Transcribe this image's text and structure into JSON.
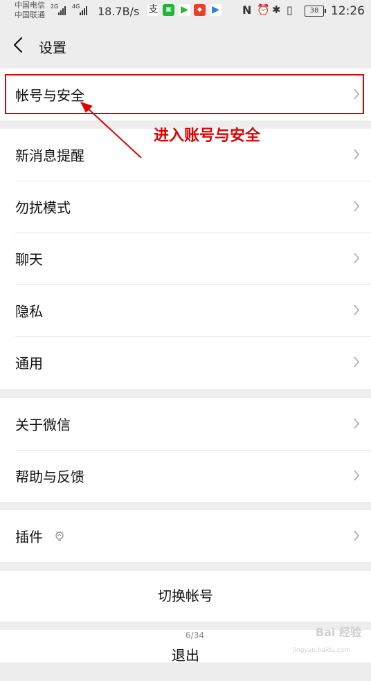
{
  "status_bar": {
    "carrier1": "中国电信",
    "carrier2": "中国联通",
    "net1": "2G",
    "net2": "4G",
    "speed": "18.7B/s",
    "battery": "38",
    "time": "12:26",
    "nfc": "N",
    "alarm": "⏰",
    "bluetooth": "✱",
    "vibrate": "▯"
  },
  "header": {
    "title": "设置"
  },
  "settings": {
    "account_security": "帐号与安全",
    "new_message_notify": "新消息提醒",
    "do_not_disturb": "勿扰模式",
    "chat": "聊天",
    "privacy": "隐私",
    "general": "通用",
    "about": "关于微信",
    "help_feedback": "帮助与反馈",
    "plugins": "插件",
    "switch_account": "切换帐号",
    "logout": "退出"
  },
  "annotation": {
    "text": "进入账号与安全"
  },
  "pager": "6/34",
  "watermark": {
    "main": "Bai 经验",
    "sub": "jingyan.baidu.com"
  },
  "colors": {
    "highlight": "#e00000",
    "background": "#ededed"
  }
}
